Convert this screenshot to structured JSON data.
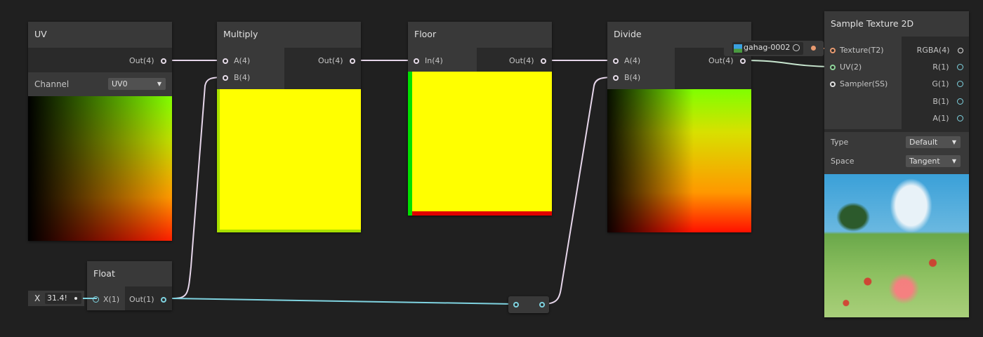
{
  "colors": {
    "background": "#202020",
    "node_body": "#2a2a2a",
    "node_header": "#393939",
    "vector_wire": "#e6d6ea",
    "float_wire": "#7fd3e0",
    "texture_port": "#e89a70",
    "uv_port": "#8ed49a"
  },
  "uv_node": {
    "title": "UV",
    "out_port": "Out(4)",
    "channel_label": "Channel",
    "channel_value": "UV0"
  },
  "multiply_node": {
    "title": "Multiply",
    "in_a": "A(4)",
    "in_b": "B(4)",
    "out_port": "Out(4)"
  },
  "floor_node": {
    "title": "Floor",
    "in_port": "In(4)",
    "out_port": "Out(4)"
  },
  "divide_node": {
    "title": "Divide",
    "in_a": "A(4)",
    "in_b": "B(4)",
    "out_port": "Out(4)"
  },
  "texture_asset": {
    "name": "gahag-0002"
  },
  "sample_node": {
    "title": "Sample Texture 2D",
    "in_texture": "Texture(T2)",
    "in_uv": "UV(2)",
    "in_sampler": "Sampler(SS)",
    "out_rgba": "RGBA(4)",
    "out_r": "R(1)",
    "out_g": "G(1)",
    "out_b": "B(1)",
    "out_a": "A(1)",
    "type_label": "Type",
    "type_value": "Default",
    "space_label": "Space",
    "space_value": "Tangent"
  },
  "float_node": {
    "title": "Float",
    "in_port": "X(1)",
    "out_port": "Out(1)",
    "field_label": "X",
    "field_value": "31.4!"
  }
}
